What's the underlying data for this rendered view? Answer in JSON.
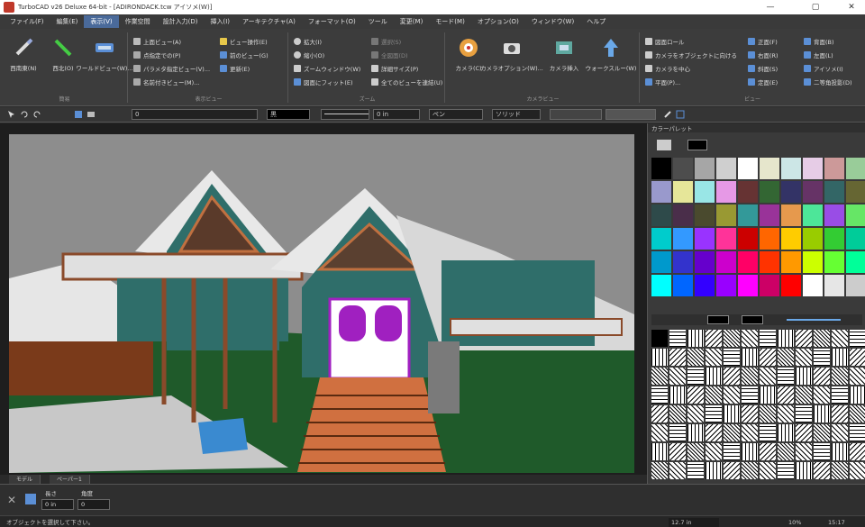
{
  "window": {
    "title": "TurboCAD v26 Deluxe 64-bit - [ADIRONDACK.tcw アイソメ(W)]"
  },
  "menu": [
    "ファイル(F)",
    "編集(E)",
    "表示(V)",
    "作業空間",
    "設計入力(D)",
    "挿入(I)",
    "アーキテクチャ(A)",
    "フォーマット(O)",
    "ツール",
    "変更(M)",
    "モード(M)",
    "オプション(O)",
    "ウィンドウ(W)",
    "ヘルプ"
  ],
  "ribbon": {
    "group1": {
      "label": "簡易",
      "buttons": [
        "西南東(N)",
        "西北(O)",
        "ワールドビュー(W)..."
      ]
    },
    "group2": {
      "label": "表示ビュー",
      "items": [
        "上面ビュー(A)",
        "点指定での(P)",
        "パラメタ指定ビュー(V)...",
        "名前付きビュー(M)...",
        "ビュー操作(E)",
        "前のビュー(G)",
        "更新(E)"
      ]
    },
    "group3": {
      "label": "ズーム",
      "items": [
        "拡大(I)",
        "縮小(O)",
        "ズームウィンドウ(W)",
        "図面にフィット(E)",
        "選択(S)",
        "全図面(D)",
        "詳細サイズ(P)",
        "全てのビューを連結(U)"
      ]
    },
    "group4": {
      "label": "カメラビュー",
      "buttons": [
        "カメラ(C)",
        "カメラオプション(W)...",
        "カメラ挿入",
        "ウォークスルー(W)"
      ]
    },
    "group5": {
      "label": "ビュー",
      "items": [
        "図面ロール",
        "カメラをオブジェクトに向ける",
        "カメラを中心",
        "平面(P)...",
        "正面(F)",
        "右面(R)",
        "斜面(S)",
        "定面(E)",
        "背面(B)",
        "左面(L)",
        "アイソメ(I)",
        "二等角投影(D)"
      ]
    }
  },
  "toolbar": {
    "layer": "0",
    "color": "黒",
    "width": "0 in",
    "pen": "ペン",
    "pattern": "ソリッド"
  },
  "palette": {
    "title": "カラーパレット",
    "colors": [
      "#000000",
      "#4d4d4d",
      "#a6a6a6",
      "#cfcfcf",
      "#ffffff",
      "#e6e6cc",
      "#cce6e6",
      "#e6cce6",
      "#cc9999",
      "#99cc99",
      "#9999cc",
      "#e6e699",
      "#99e6e6",
      "#e699e6",
      "#663333",
      "#336633",
      "#333366",
      "#663366",
      "#336666",
      "#666633",
      "#2e4a4a",
      "#4a2e4a",
      "#4a4a2e",
      "#999933",
      "#339999",
      "#993399",
      "#e6994d",
      "#4de699",
      "#994de6",
      "#66e666",
      "#00cccc",
      "#3399ff",
      "#9933ff",
      "#ff3399",
      "#cc0000",
      "#ff6600",
      "#ffcc00",
      "#99cc00",
      "#33cc33",
      "#00cc99",
      "#0099cc",
      "#3333cc",
      "#6600cc",
      "#cc00cc",
      "#ff0066",
      "#ff3300",
      "#ff9900",
      "#ccff00",
      "#66ff33",
      "#00ff99",
      "#00ffff",
      "#0066ff",
      "#3300ff",
      "#9900ff",
      "#ff00ff",
      "#cc0066",
      "#ff0000",
      "#ffffff",
      "#e6e6e6",
      "#cccccc"
    ],
    "fill_color": "#000000",
    "line_color": "#000000"
  },
  "viewport_tabs": [
    "モデル",
    "ペーパー1"
  ],
  "bottom": {
    "label1": "長さ",
    "label2": "角度",
    "value1": "0 in",
    "value2": "0"
  },
  "status": {
    "hint": "オブジェクトを選択して下さい。",
    "zoom": "10%",
    "time": "15:17",
    "coords": "12.7 in"
  }
}
